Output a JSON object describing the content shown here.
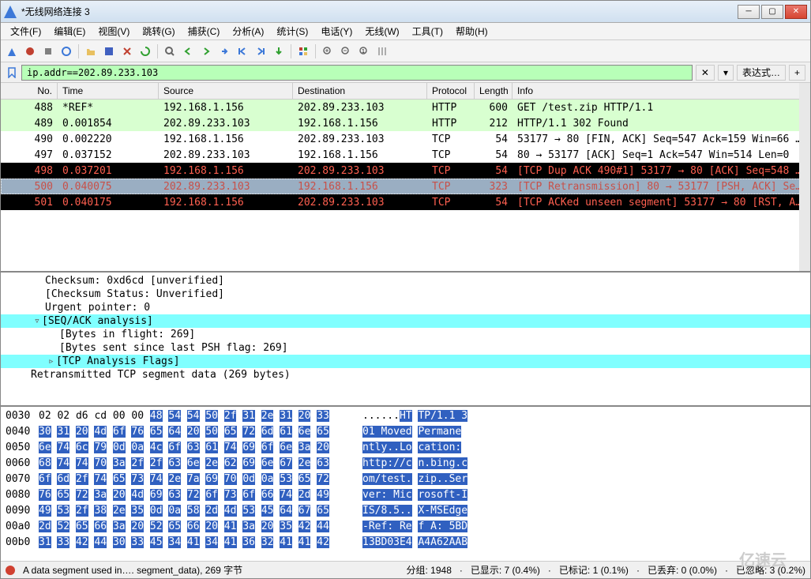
{
  "window": {
    "title": "*无线网络连接 3"
  },
  "menu": {
    "file": "文件(F)",
    "edit": "编辑(E)",
    "view": "视图(V)",
    "go": "跳转(G)",
    "capture": "捕获(C)",
    "analyze": "分析(A)",
    "stats": "统计(S)",
    "telephony": "电话(Y)",
    "wireless": "无线(W)",
    "tools": "工具(T)",
    "help": "帮助(H)"
  },
  "filter": {
    "value": "ip.addr==202.89.233.103",
    "expr": "表达式…"
  },
  "columns": {
    "no": "No.",
    "time": "Time",
    "source": "Source",
    "destination": "Destination",
    "protocol": "Protocol",
    "length": "Length",
    "info": "Info"
  },
  "packets": [
    {
      "no": "488",
      "time": "*REF*",
      "src": "192.168.1.156",
      "dst": "202.89.233.103",
      "proto": "HTTP",
      "len": "600",
      "info": "GET /test.zip HTTP/1.1",
      "bg": "#d8ffd0",
      "fg": "#000"
    },
    {
      "no": "489",
      "time": "0.001854",
      "src": "202.89.233.103",
      "dst": "192.168.1.156",
      "proto": "HTTP",
      "len": "212",
      "info": "HTTP/1.1 302 Found",
      "bg": "#d8ffd0",
      "fg": "#000"
    },
    {
      "no": "490",
      "time": "0.002220",
      "src": "192.168.1.156",
      "dst": "202.89.233.103",
      "proto": "TCP",
      "len": "54",
      "info": "53177 → 80 [FIN, ACK] Seq=547 Ack=159 Win=66 …",
      "bg": "#ffffff",
      "fg": "#000"
    },
    {
      "no": "497",
      "time": "0.037152",
      "src": "202.89.233.103",
      "dst": "192.168.1.156",
      "proto": "TCP",
      "len": "54",
      "info": "80 → 53177 [ACK] Seq=1 Ack=547 Win=514 Len=0",
      "bg": "#ffffff",
      "fg": "#000"
    },
    {
      "no": "498",
      "time": "0.037201",
      "src": "192.168.1.156",
      "dst": "202.89.233.103",
      "proto": "TCP",
      "len": "54",
      "info": "[TCP Dup ACK 490#1] 53177 → 80 [ACK] Seq=548 …",
      "bg": "#000000",
      "fg": "#ff6050"
    },
    {
      "no": "500",
      "time": "0.040075",
      "src": "202.89.233.103",
      "dst": "192.168.1.156",
      "proto": "TCP",
      "len": "323",
      "info": "[TCP Retransmission] 80 → 53177 [PSH, ACK] Se…",
      "bg": "#9aaec2",
      "fg": "#c85048"
    },
    {
      "no": "501",
      "time": "0.040175",
      "src": "192.168.1.156",
      "dst": "202.89.233.103",
      "proto": "TCP",
      "len": "54",
      "info": "[TCP ACKed unseen segment] 53177 → 80 [RST, A…",
      "bg": "#000000",
      "fg": "#ff6050"
    }
  ],
  "details": [
    {
      "text": "Checksum: 0xd6cd [unverified]",
      "indent": 2,
      "hl": false
    },
    {
      "text": "[Checksum Status: Unverified]",
      "indent": 2,
      "hl": false
    },
    {
      "text": "Urgent pointer: 0",
      "indent": 2,
      "hl": false
    },
    {
      "text": "[SEQ/ACK analysis]",
      "indent": 2,
      "hl": true,
      "tri": "▿"
    },
    {
      "text": "[Bytes in flight: 269]",
      "indent": 3,
      "hl": false
    },
    {
      "text": "[Bytes sent since last PSH flag: 269]",
      "indent": 3,
      "hl": false
    },
    {
      "text": "[TCP Analysis Flags]",
      "indent": 3,
      "hl": true,
      "tri": "▹"
    },
    {
      "text": "Retransmitted TCP segment data (269 bytes)",
      "indent": 1,
      "hl": false
    }
  ],
  "hex": [
    {
      "off": "0030",
      "bytes": "02 02 d6 cd 00 00 48 54  54 50 2f 31 2e 31 20 33",
      "ascii": "......HT TP/1.1 3",
      "selStart": 6
    },
    {
      "off": "0040",
      "bytes": "30 31 20 4d 6f 76 65 64  20 50 65 72 6d 61 6e 65",
      "ascii": "01 Moved  Permane",
      "selStart": 0
    },
    {
      "off": "0050",
      "bytes": "6e 74 6c 79 0d 0a 4c 6f  63 61 74 69 6f 6e 3a 20",
      "ascii": "ntly..Lo cation: ",
      "selStart": 0
    },
    {
      "off": "0060",
      "bytes": "68 74 74 70 3a 2f 2f 63  6e 2e 62 69 6e 67 2e 63",
      "ascii": "http://c n.bing.c",
      "selStart": 0
    },
    {
      "off": "0070",
      "bytes": "6f 6d 2f 74 65 73 74 2e  7a 69 70 0d 0a 53 65 72",
      "ascii": "om/test. zip..Ser",
      "selStart": 0
    },
    {
      "off": "0080",
      "bytes": "76 65 72 3a 20 4d 69 63  72 6f 73 6f 66 74 2d 49",
      "ascii": "ver: Mic rosoft-I",
      "selStart": 0
    },
    {
      "off": "0090",
      "bytes": "49 53 2f 38 2e 35 0d 0a  58 2d 4d 53 45 64 67 65",
      "ascii": "IS/8.5.. X-MSEdge",
      "selStart": 0
    },
    {
      "off": "00a0",
      "bytes": "2d 52 65 66 3a 20 52 65  66 20 41 3a 20 35 42 44",
      "ascii": "-Ref: Re f A: 5BD",
      "selStart": 0
    },
    {
      "off": "00b0",
      "bytes": "31 33 42 44 30 33 45 34  41 34 41 36 32 41 41 42",
      "ascii": "13BD03E4 A4A62AAB",
      "selStart": 0
    }
  ],
  "status": {
    "text": "A data segment used in…. segment_data), 269 字节",
    "groups": "分组: 1948",
    "shown": "已显示: 7 (0.4%)",
    "marked": "已标记: 1 (0.1%)",
    "dropped": "已丢弃: 0 (0.0%)",
    "ignored": "已忽略: 3 (0.2%)"
  },
  "watermark": "亿速云"
}
